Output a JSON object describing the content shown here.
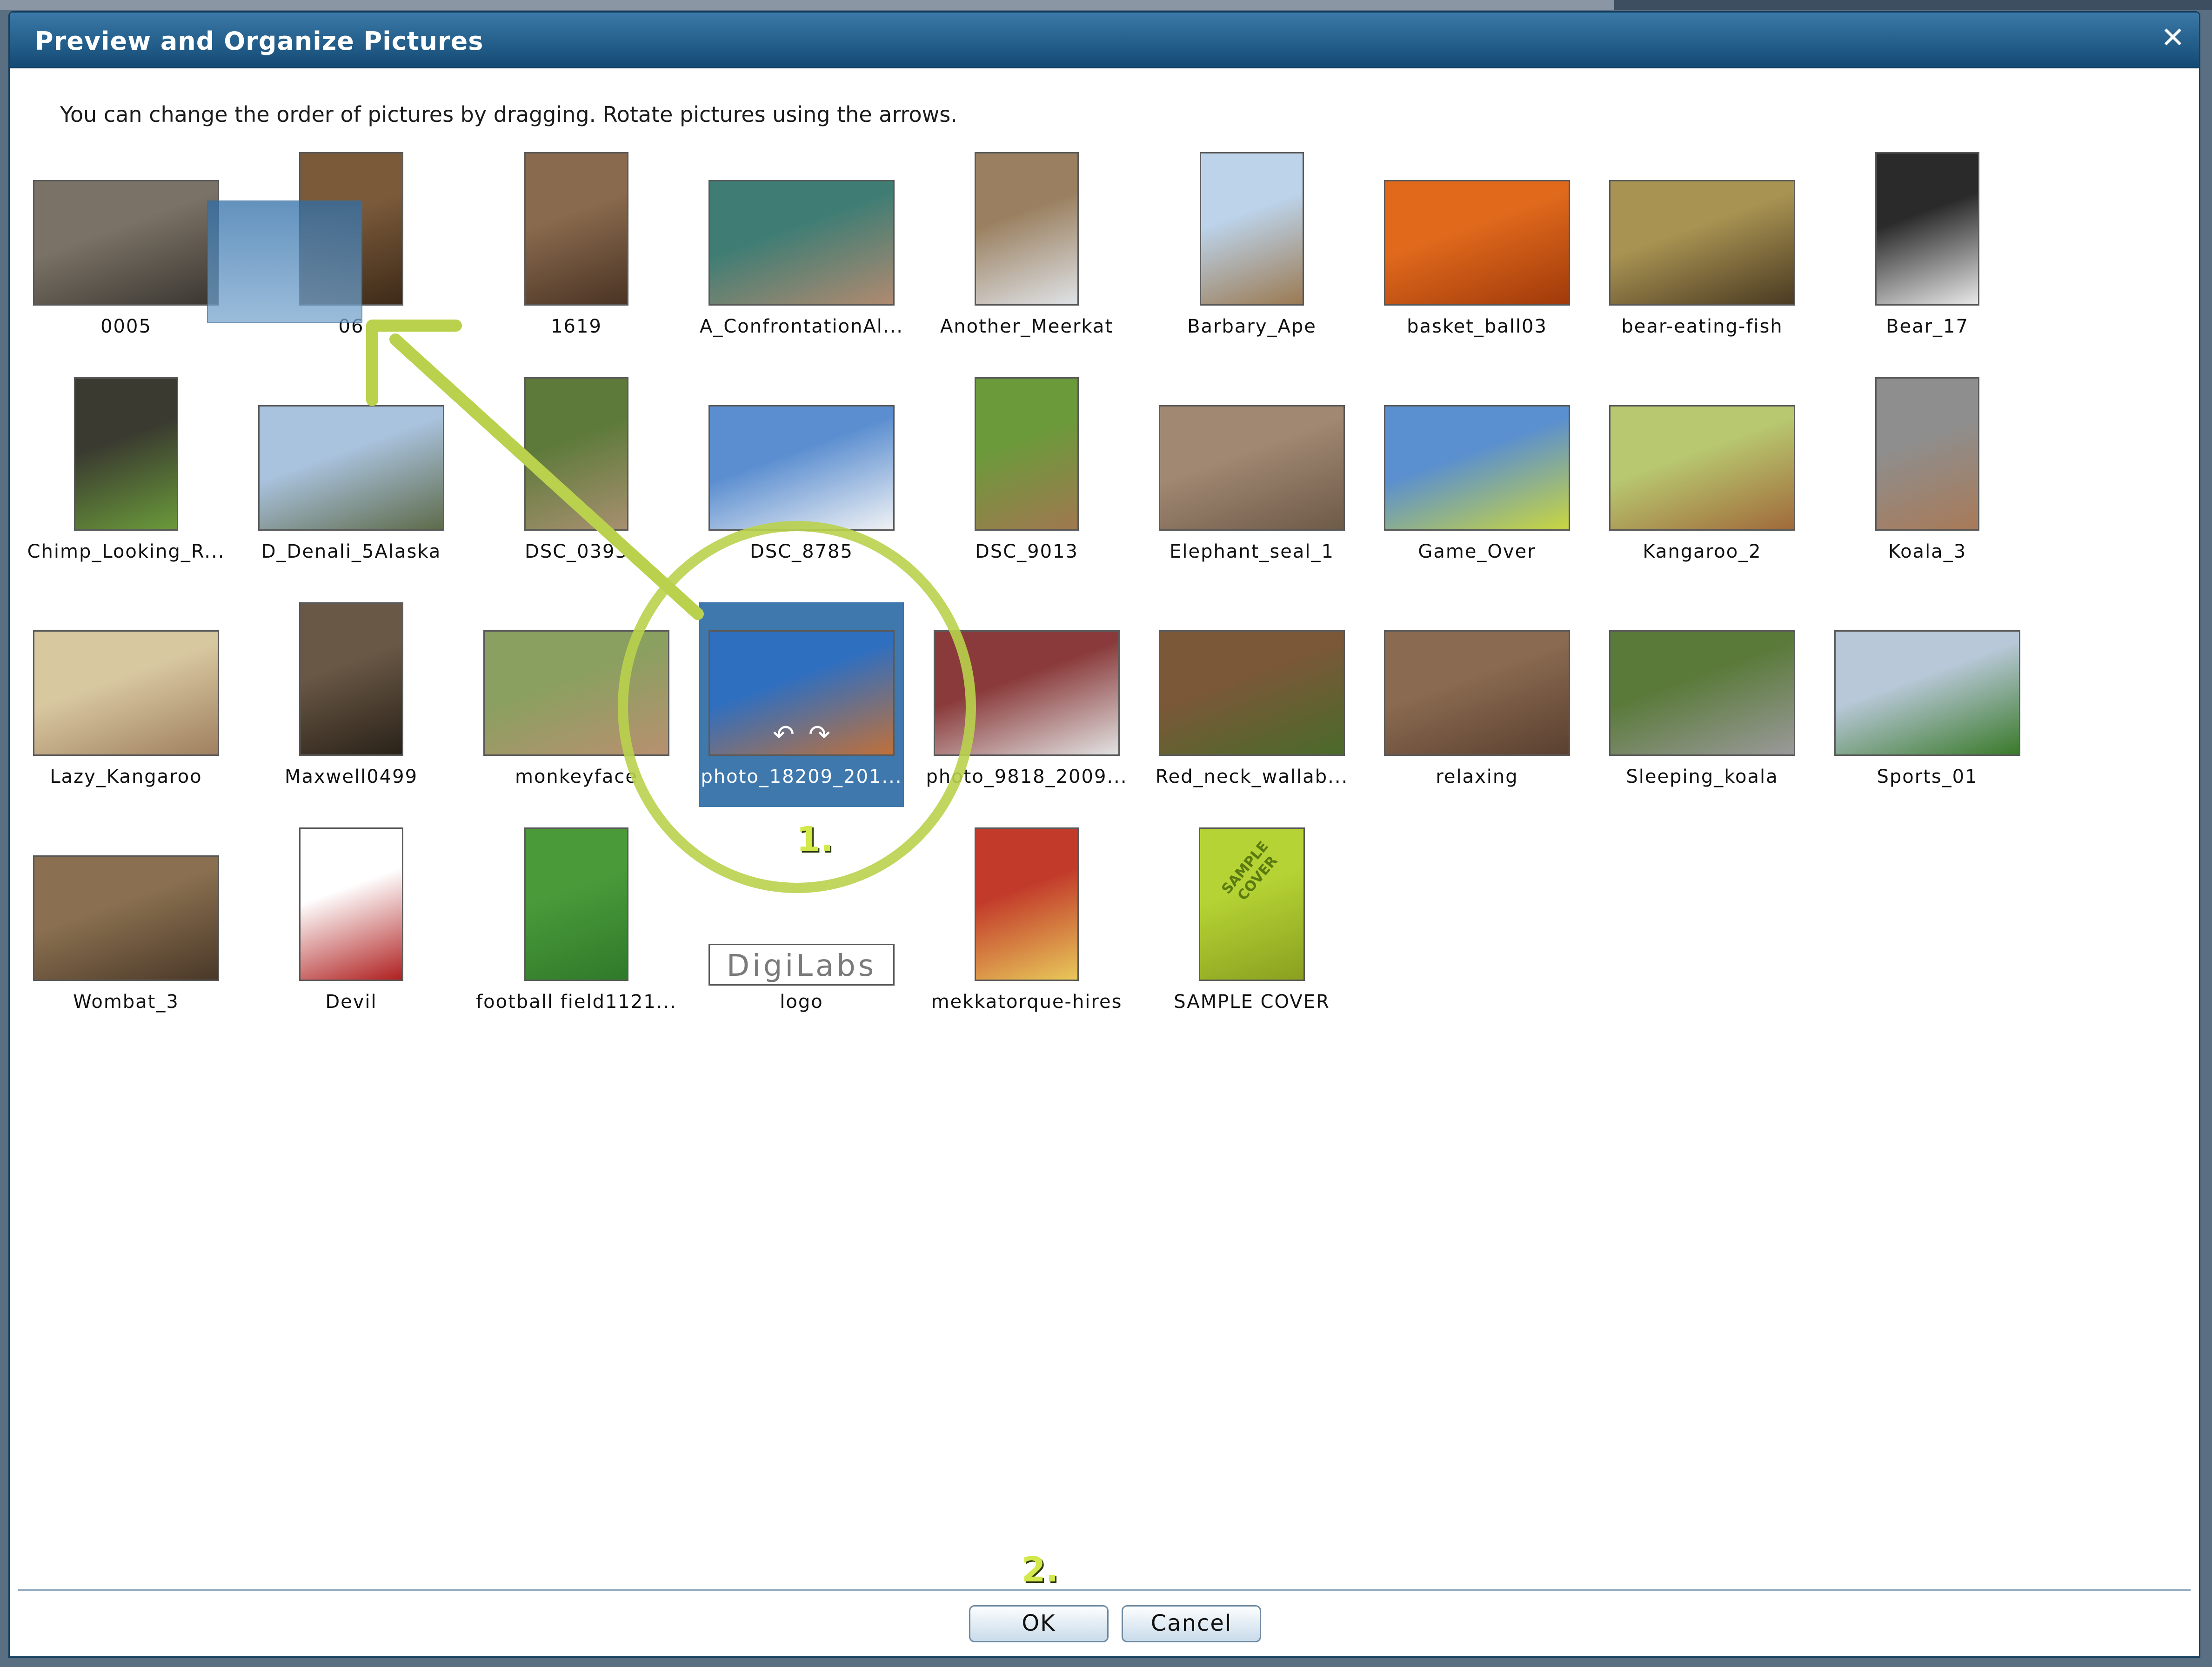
{
  "dialog": {
    "title": "Preview and Organize Pictures",
    "instructions": "You can change the order of pictures by dragging. Rotate pictures using the arrows."
  },
  "pictures": [
    {
      "label": "0005",
      "kind": "landscape",
      "colors": [
        "#7a7266",
        "#3a3630"
      ]
    },
    {
      "label": "06",
      "kind": "portrait",
      "colors": [
        "#7b5a3a",
        "#3d2a18"
      ]
    },
    {
      "label": "1619",
      "kind": "portrait",
      "colors": [
        "#8a6a4e",
        "#4a3424"
      ]
    },
    {
      "label": "A_ConfrontationAl...",
      "kind": "landscape",
      "colors": [
        "#3f7d74",
        "#b08a70"
      ]
    },
    {
      "label": "Another_Meerkat",
      "kind": "portrait",
      "colors": [
        "#9a8060",
        "#dfe2e6"
      ]
    },
    {
      "label": "Barbary_Ape",
      "kind": "portrait",
      "colors": [
        "#bcd3ea",
        "#9b7a52"
      ]
    },
    {
      "label": "basket_ball03",
      "kind": "landscape",
      "colors": [
        "#e0691c",
        "#a03a0a"
      ]
    },
    {
      "label": "bear-eating-fish",
      "kind": "landscape",
      "colors": [
        "#a99352",
        "#4a3a22"
      ]
    },
    {
      "label": "Bear_17",
      "kind": "portrait",
      "colors": [
        "#2a2a2a",
        "#e8e8e8"
      ]
    },
    {
      "label": "Chimp_Looking_R...",
      "kind": "portrait",
      "colors": [
        "#3a3a30",
        "#6a9a3a"
      ]
    },
    {
      "label": "D_Denali_5Alaska",
      "kind": "landscape",
      "colors": [
        "#a9c2dd",
        "#5e6b4a"
      ]
    },
    {
      "label": "DSC_0393",
      "kind": "portrait",
      "colors": [
        "#5d7a3a",
        "#a89070"
      ]
    },
    {
      "label": "DSC_8785",
      "kind": "landscape",
      "colors": [
        "#5b8ed0",
        "#f0f2f5"
      ]
    },
    {
      "label": "DSC_9013",
      "kind": "portrait",
      "colors": [
        "#6b9a3a",
        "#a07850"
      ]
    },
    {
      "label": "Elephant_seal_1",
      "kind": "landscape",
      "colors": [
        "#a08872",
        "#6e5a48"
      ]
    },
    {
      "label": "Game_Over",
      "kind": "landscape",
      "colors": [
        "#5a8fd0",
        "#c9d640"
      ]
    },
    {
      "label": "Kangaroo_2",
      "kind": "landscape",
      "colors": [
        "#b8c870",
        "#a06a3a"
      ]
    },
    {
      "label": "Koala_3",
      "kind": "portrait",
      "colors": [
        "#8e8e8e",
        "#a87a58"
      ]
    },
    {
      "label": "Lazy_Kangaroo",
      "kind": "landscape",
      "colors": [
        "#d8c8a0",
        "#a08060"
      ]
    },
    {
      "label": "Maxwell0499",
      "kind": "portrait",
      "colors": [
        "#6a5846",
        "#2a2218"
      ]
    },
    {
      "label": "monkeyface",
      "kind": "landscape",
      "colors": [
        "#8aa060",
        "#b89070"
      ]
    },
    {
      "label": "photo_18209_201...",
      "kind": "landscape",
      "colors": [
        "#2f6fc0",
        "#c0703a"
      ],
      "selected": true
    },
    {
      "label": "photo_9818_2009...",
      "kind": "landscape",
      "colors": [
        "#8a3a3a",
        "#e2e2e2"
      ]
    },
    {
      "label": "Red_neck_wallab...",
      "kind": "landscape",
      "colors": [
        "#7a5838",
        "#4a6a2a"
      ]
    },
    {
      "label": "relaxing",
      "kind": "landscape",
      "colors": [
        "#8a6a50",
        "#5a4030"
      ]
    },
    {
      "label": "Sleeping_koala",
      "kind": "landscape",
      "colors": [
        "#5a7a3a",
        "#9a9a9a"
      ]
    },
    {
      "label": "Sports_01",
      "kind": "landscape",
      "colors": [
        "#b8c8d8",
        "#3a7a2a"
      ]
    },
    {
      "label": "Wombat_3",
      "kind": "landscape",
      "colors": [
        "#8a7050",
        "#4a3828"
      ]
    },
    {
      "label": "Devil",
      "kind": "portrait",
      "colors": [
        "#ffffff",
        "#b02020"
      ]
    },
    {
      "label": "football field1121...",
      "kind": "portrait",
      "colors": [
        "#4a9a3a",
        "#2f7a2a"
      ]
    },
    {
      "label": "logo",
      "kind": "logo",
      "colors": [
        "#ffffff",
        "#888888"
      ],
      "logo_text": "DigiLabs"
    },
    {
      "label": "mekkatorque-hires",
      "kind": "portrait",
      "colors": [
        "#c23a2a",
        "#e8c85a"
      ]
    },
    {
      "label": "SAMPLE COVER",
      "kind": "cover",
      "colors": [
        "#b5d334",
        "#8aa020"
      ],
      "cover_text": "SAMPLE COVER"
    }
  ],
  "buttons": {
    "ok": "OK",
    "cancel": "Cancel"
  },
  "annotations": {
    "step1": "1.",
    "step2": "2."
  },
  "icons": {
    "close": "close-icon",
    "rotate_left": "rotate-left-icon",
    "rotate_right": "rotate-right-icon"
  },
  "colors": {
    "title_bar": "#134a74",
    "selection": "#3f78ad",
    "highlight": "#b9d14c"
  }
}
